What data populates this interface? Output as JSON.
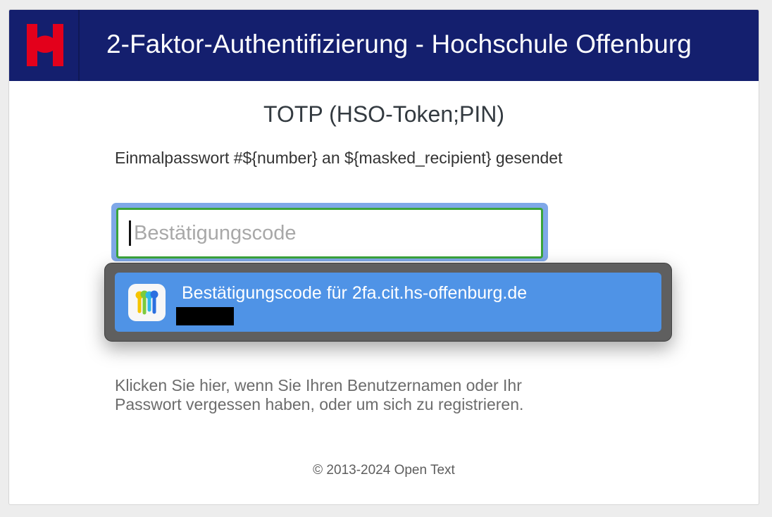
{
  "header": {
    "title": "2-Faktor-Authentifizierung - Hochschule Offenburg",
    "logo_icon": "hso-logo-icon",
    "background_color": "#141f6e",
    "logo_color": "#e3001b"
  },
  "main": {
    "method_title": "TOTP (HSO-Token;PIN)",
    "sent_message": "Einmalpasswort #${number} an ${masked_recipient} gesendet",
    "code_input": {
      "value": "",
      "placeholder": "Bestätigungscode"
    },
    "autofill": {
      "icon": "passwords-keys-icon",
      "label": "Bestätigungscode für 2fa.cit.hs-offenburg.de",
      "accent_color": "#4f93e6"
    },
    "forgot_link": "Klicken Sie hier, wenn Sie Ihren Benutzernamen oder Ihr Passwort vergessen haben, oder um sich zu registrieren."
  },
  "footer": {
    "copyright": "© 2013-2024 Open Text"
  }
}
